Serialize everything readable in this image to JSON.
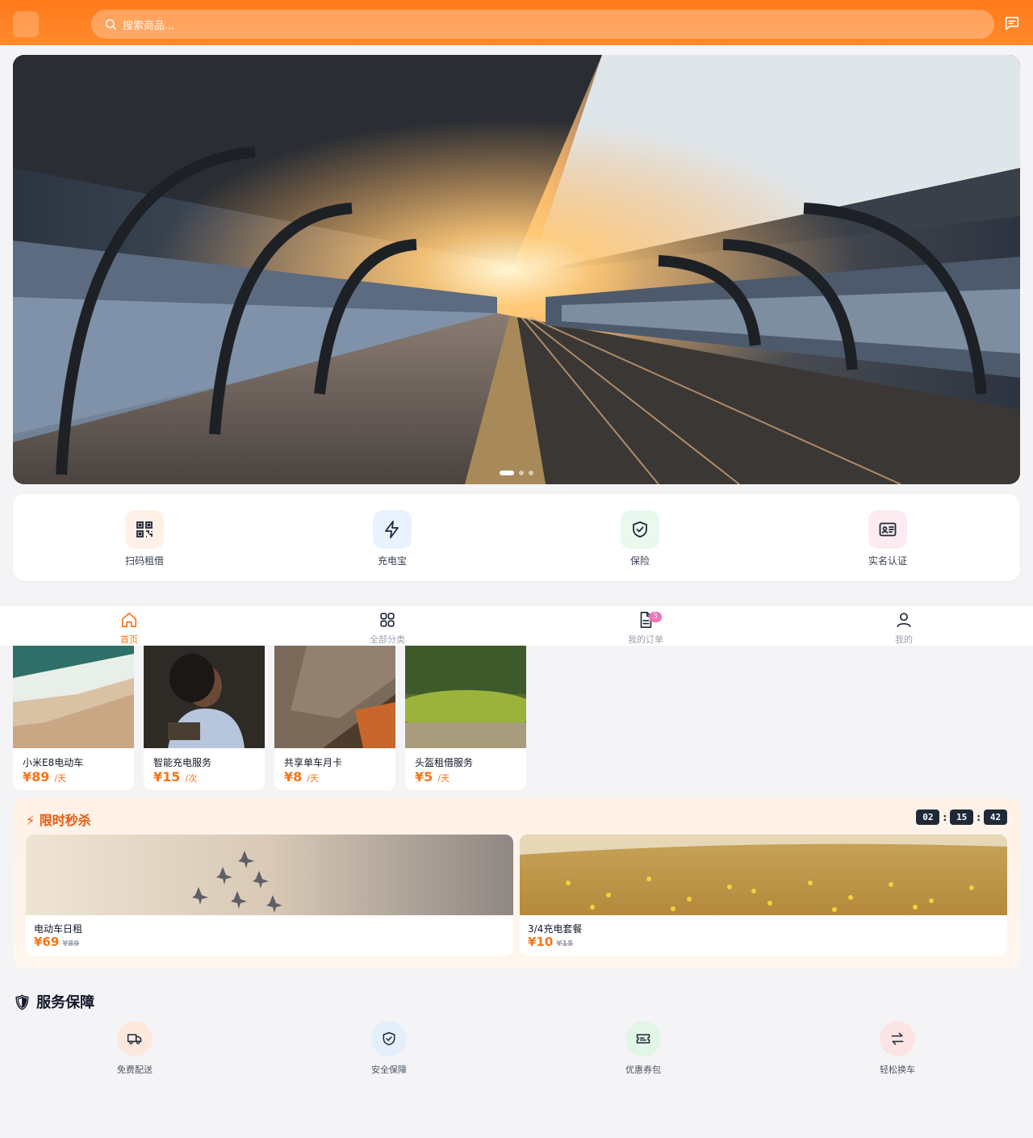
{
  "header": {
    "logo_glyph": "",
    "app_title": "",
    "search_placeholder": "搜索商品...",
    "icons": {
      "search": "search-icon",
      "messages": "message-icon"
    },
    "accent": "#ff7a1a"
  },
  "banner": {
    "image": "railway platform at sunset",
    "slide_count": 3,
    "active_slide": 1
  },
  "quick_actions": [
    {
      "label": "扫码租借",
      "icon": "qr-code-icon",
      "bg": "#fff1e8"
    },
    {
      "label": "充电宝",
      "icon": "lightning-icon",
      "bg": "#eaf2ff"
    },
    {
      "label": "保险",
      "icon": "shield-check-icon",
      "bg": "#e9f9ee"
    },
    {
      "label": "实名认证",
      "icon": "id-card-icon",
      "bg": "#fdecef"
    }
  ],
  "bottom_nav": [
    {
      "label": "首页",
      "icon": "home-icon",
      "active": true
    },
    {
      "label": "全部分类",
      "icon": "grid-icon",
      "active": false
    },
    {
      "label": "我的订单",
      "icon": "document-icon",
      "active": false,
      "badge": "3"
    },
    {
      "label": "我的",
      "icon": "user-icon",
      "active": false
    }
  ],
  "products": [
    {
      "name": "小米E8电动车",
      "price": "¥89",
      "unit": "/天",
      "image": "beach-waves"
    },
    {
      "name": "智能充电服务",
      "price": "¥15",
      "unit": "/次",
      "image": "woman-reading"
    },
    {
      "name": "共享单车月卡",
      "price": "¥8",
      "unit": "/天",
      "image": "tree-bark"
    },
    {
      "name": "头盔租借服务",
      "price": "¥5",
      "unit": "/天",
      "image": "mossy-forest"
    }
  ],
  "flash_sale": {
    "title": "⚡ 限时秒杀",
    "timer": {
      "hours": "02",
      "minutes": "15",
      "seconds": "42"
    },
    "items": [
      {
        "name": "电动车日租",
        "price": "¥69",
        "original_price": "¥89",
        "image": "jets-formation"
      },
      {
        "name": "3/4充电套餐",
        "price": "¥10",
        "original_price": "¥15",
        "image": "yellow-flowers-field"
      }
    ]
  },
  "services": {
    "title": "🛡 服务保障",
    "items": [
      {
        "label": "免费配送",
        "icon": "truck-icon",
        "bg": "#fde8de"
      },
      {
        "label": "安全保障",
        "icon": "shield-check-icon",
        "bg": "#e3effa"
      },
      {
        "label": "优惠券包",
        "icon": "ticket-icon",
        "bg": "#e1f6e6"
      },
      {
        "label": "轻松换车",
        "icon": "swap-icon",
        "bg": "#fde4e4"
      }
    ]
  }
}
